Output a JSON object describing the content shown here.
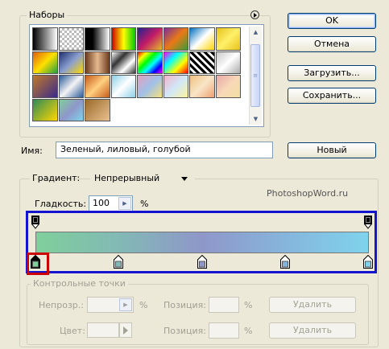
{
  "presets": {
    "title": "Наборы",
    "menu_icon": "menu-arrow-icon",
    "swatches": [
      [
        "linear-gradient(90deg,#000,#fff)",
        "repeating-conic-gradient(#bbb 0 25%,#fff 0 50%) 0 0/6px 6px",
        "linear-gradient(90deg,#000,#000 30%,#fff)",
        "linear-gradient(90deg,#c00,#ff0,#0c0)",
        "linear-gradient(135deg,#22238f,#c31b67,#e2be25)",
        "linear-gradient(135deg,#7b2c99,#ea7a16,#3a9a3a)",
        "linear-gradient(135deg,#0070c0,#fff,#ffd400)",
        "linear-gradient(135deg,#e6c21a,#fff06a,#e6c21a)"
      ],
      [
        "linear-gradient(135deg,#e06010,#ffe000,#20a040)",
        "linear-gradient(135deg,#20306e,#8a9fd0,#ffd800)",
        "linear-gradient(90deg,#6a3a1a,#e5b890,#6a3a1a)",
        "linear-gradient(135deg,#fff,#333,#fff,#333)",
        "linear-gradient(135deg,#f00,#ff0,#0f0,#0ff,#00f,#f0f)",
        "linear-gradient(135deg,#f0f,#0ff,#ff0,#f00)",
        "repeating-linear-gradient(45deg,#000 0 3px,#fff 3px 6px)",
        "linear-gradient(135deg,#c8c8c8,#fff,#aaa)"
      ],
      [
        "linear-gradient(135deg,#c27a2a,#3a2a8a)",
        "linear-gradient(135deg,#2a5a9a,#f4f4f4,#2a5a9a)",
        "linear-gradient(135deg,#c65a18,#ffd080,#c65a18)",
        "linear-gradient(135deg,#8ad0e8,#fff,#8ad0e8)",
        "linear-gradient(135deg,#e3a0c0,#a0c0e8,#f6e07a)",
        "linear-gradient(135deg,#f4b2c8,#d0e8f8,#fef3a0)",
        "linear-gradient(135deg,#f0c080,#f8e6c8,#f0a070)",
        "linear-gradient(135deg,#e8a8a8,#f8d8b8,#f0e0a0)"
      ],
      [
        "linear-gradient(135deg,#2e8b57,#ffd700)",
        "linear-gradient(135deg,#7fcf9b,#8f97c9,#7fd3ec)",
        "linear-gradient(135deg,#9b6a2a,#e8c090)"
      ]
    ]
  },
  "buttons": {
    "ok": "OK",
    "cancel": "Отмена",
    "load": "Загрузить...",
    "save": "Сохранить...",
    "new": "Новый"
  },
  "name": {
    "label": "Имя:",
    "value": "Зеленый, лиловый, голубой"
  },
  "gradient": {
    "type_label": "Градиент:",
    "type_value": "Непрерывный",
    "smoothness_label": "Гладкость:",
    "smoothness_value": "100",
    "percent": "%",
    "watermark": "PhotoshopWord.ru",
    "colors": [
      "#7fcf9b",
      "#82b9b5",
      "#8f97c9",
      "#86b5dc",
      "#7fd3ec"
    ],
    "opacity_stops": [
      0,
      1
    ],
    "color_stops": [
      0,
      0.25,
      0.5,
      0.75,
      1
    ],
    "selected_color_stop": 0
  },
  "stops_panel": {
    "title": "Контрольные точки",
    "opacity_label": "Непрозр.:",
    "color_label": "Цвет:",
    "position_label": "Позиция:",
    "percent": "%",
    "delete_label": "Удалить"
  }
}
